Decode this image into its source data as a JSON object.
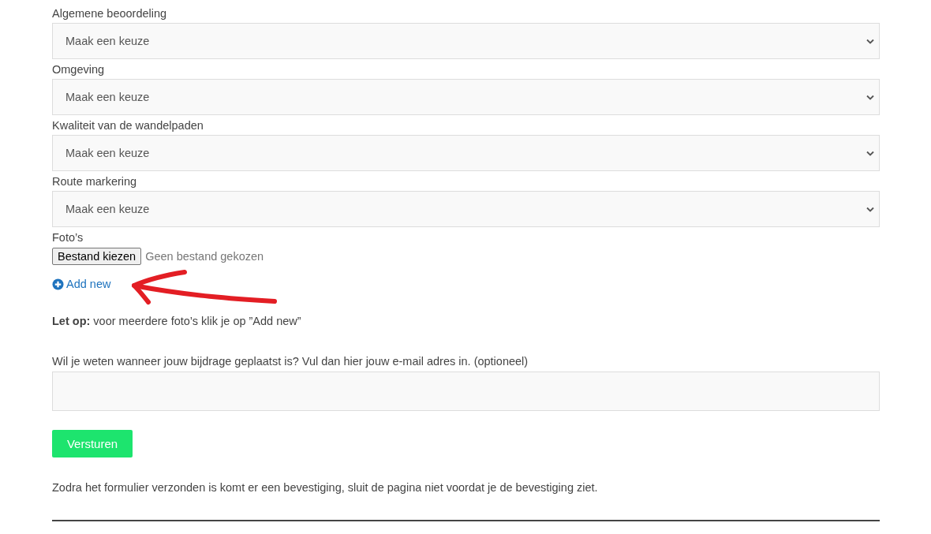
{
  "fields": [
    {
      "kind": "select",
      "label": "Algemene beoordeling",
      "value": "Maak een keuze"
    },
    {
      "kind": "select",
      "label": "Omgeving",
      "value": "Maak een keuze"
    },
    {
      "kind": "select",
      "label": "Kwaliteit van de wandelpaden",
      "value": "Maak een keuze"
    },
    {
      "kind": "select",
      "label": "Route markering",
      "value": "Maak een keuze"
    },
    {
      "kind": "file",
      "label": "Foto’s",
      "button": "Bestand kiezen",
      "status": "Geen bestand gekozen"
    }
  ],
  "add_link": {
    "label": "Add new"
  },
  "note": "**Let op:** voor meerdere foto’s klik je op ”Add new”",
  "email": {
    "label": "Wil je weten wanneer jouw bijdrage geplaatst is? Vul dan hier jouw e-mail adres in. (optioneel)"
  },
  "submit": "Versturen",
  "notice": "Zodra het formulier verzonden is komt er een bevestiging, sluit de pagina niet voordat je de bevestiging ziet."
}
